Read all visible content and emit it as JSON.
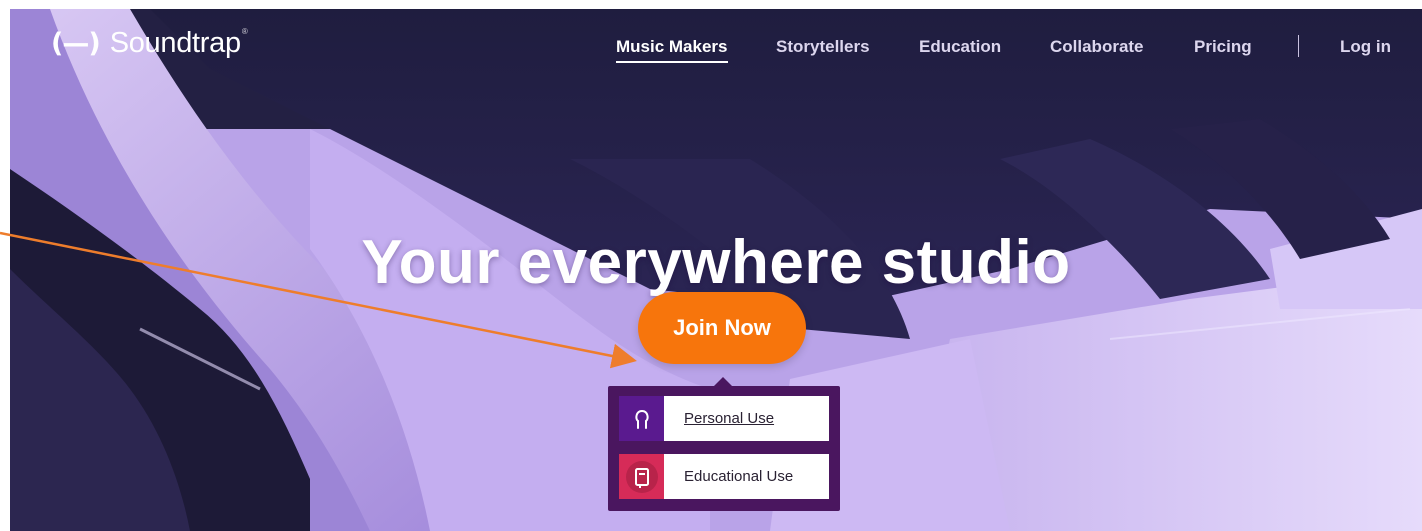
{
  "header": {
    "logo": {
      "mark": "(—)",
      "text": "Soundtrap",
      "reg": "®"
    },
    "nav": [
      {
        "label": "Music Makers",
        "active": true
      },
      {
        "label": "Storytellers",
        "active": false
      },
      {
        "label": "Education",
        "active": false
      },
      {
        "label": "Collaborate",
        "active": false
      },
      {
        "label": "Pricing",
        "active": false
      }
    ],
    "login_label": "Log in"
  },
  "hero": {
    "title": "Your everywhere studio",
    "join_label": "Join Now"
  },
  "join_menu": {
    "options": [
      {
        "label": "Personal Use",
        "icon": "person-icon",
        "color": "#5a1a8f"
      },
      {
        "label": "Educational Use",
        "icon": "tablet-icon",
        "color": "#d62b58"
      }
    ]
  },
  "colors": {
    "accent": "#f7750c",
    "menu_bg": "#4a165f",
    "annotation_arrow": "#ee7d2c"
  }
}
